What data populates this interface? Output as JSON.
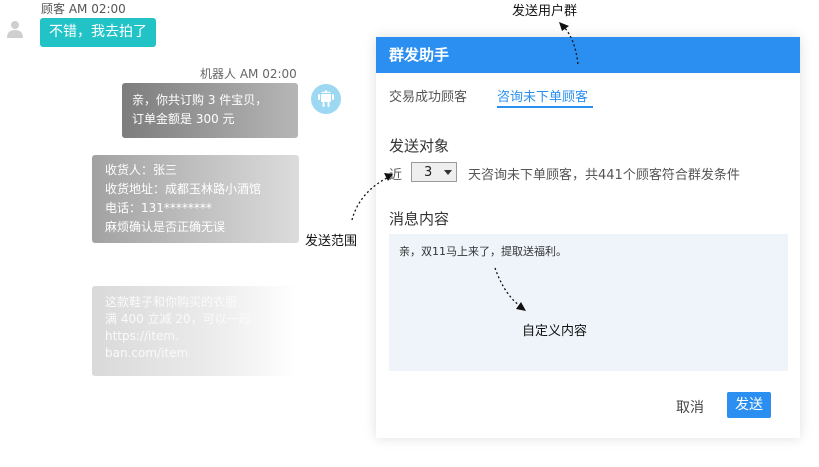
{
  "chat": {
    "customer_meta": "顾客  AM 02:00",
    "customer_message": "不错，我去拍了",
    "robot_meta": "机器人  AM 02:00",
    "robot_message_lines": [
      "亲，你共订购 3 件宝贝，",
      "订单金额是 300 元"
    ],
    "address_lines": [
      "收货人：张三",
      "收货地址：成都玉林路小酒馆",
      "电话：131********",
      "麻烦确认是否正确无误"
    ],
    "faded_lines": [
      "这款鞋子和你购买的衣服",
      "满 400 立减 20，可以一起",
      "https://item.",
      "ban.com/item"
    ]
  },
  "annotations": {
    "group_note": "发送用户群",
    "range_note": "发送范围",
    "content_note": "自定义内容"
  },
  "dialog": {
    "title": "群发助手",
    "tabs": [
      "交易成功顾客",
      "咨询未下单顾客"
    ],
    "active_tab": "咨询未下单顾客",
    "target_label": "发送对象",
    "near_label": "近",
    "days_value": "3",
    "range_text": "天咨询未下单顾客，共441个顾客符合群发条件",
    "content_label": "消息内容",
    "message_text": "亲，双11马上来了，提取送福利。",
    "cancel_label": "取消",
    "send_label": "发送"
  },
  "colors": {
    "accent": "#2a8ff0",
    "customer_bubble": "#22c3c7",
    "message_area_bg": "#eef4fa"
  }
}
